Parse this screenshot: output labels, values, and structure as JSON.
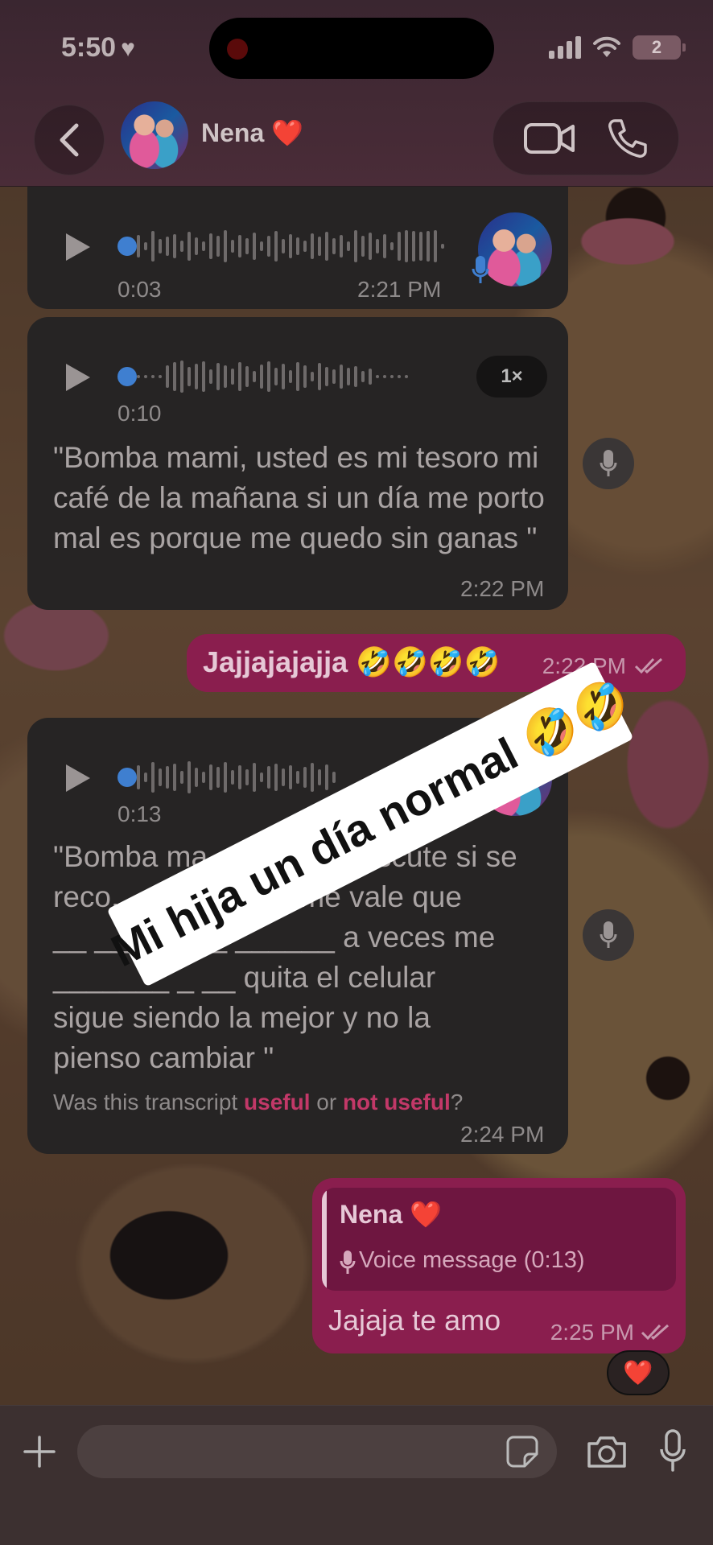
{
  "status_bar": {
    "time": "5:50",
    "time_icon": "heart-icon",
    "battery_level": "2"
  },
  "header": {
    "contact_name": "Nena ❤️"
  },
  "messages": [
    {
      "type": "voice",
      "direction": "incoming",
      "duration": "0:03",
      "time": "2:21 PM"
    },
    {
      "type": "voice",
      "direction": "incoming",
      "duration": "0:10",
      "speed": "1×",
      "transcript": "\"Bomba mami, usted es mi tesoro mi café de la mañana si un día me porto mal es porque me quedo sin ganas \"",
      "time": "2:22 PM"
    },
    {
      "type": "text",
      "direction": "outgoing",
      "text": "Jajjajajajja 🤣🤣🤣🤣",
      "time": "2:22 PM",
      "status": "read"
    },
    {
      "type": "voice",
      "direction": "incoming",
      "duration": "0:13",
      "transcript_lines": [
        "\"Bomba ma... nadie lo discute si se",
        "reco... cuarto más me vale que",
        "__ ________ ______ a veces me",
        "_______ _ __ quita el celular",
        "sigue siendo la mejor y no la",
        "pienso cambiar \""
      ],
      "feedback_prefix": "Was this transcript ",
      "feedback_useful": "useful",
      "feedback_or": " or ",
      "feedback_not_useful": "not useful",
      "feedback_suffix": "?",
      "time": "2:24 PM"
    },
    {
      "type": "reply",
      "direction": "outgoing",
      "quoted_name": "Nena ❤️",
      "quoted_text": "Voice message (0:13)",
      "text": "Jajaja te amo",
      "time": "2:25 PM",
      "status": "read",
      "reaction": "❤️"
    }
  ],
  "overlay": {
    "caption": "Mi hija un día normal 🤣🤣"
  },
  "composer": {
    "placeholder": ""
  },
  "colors": {
    "outgoing_bubble": "#8a1e4e",
    "incoming_bubble": "#262424",
    "voice_dot": "#3f7fd0",
    "link_accent": "#c23868"
  }
}
